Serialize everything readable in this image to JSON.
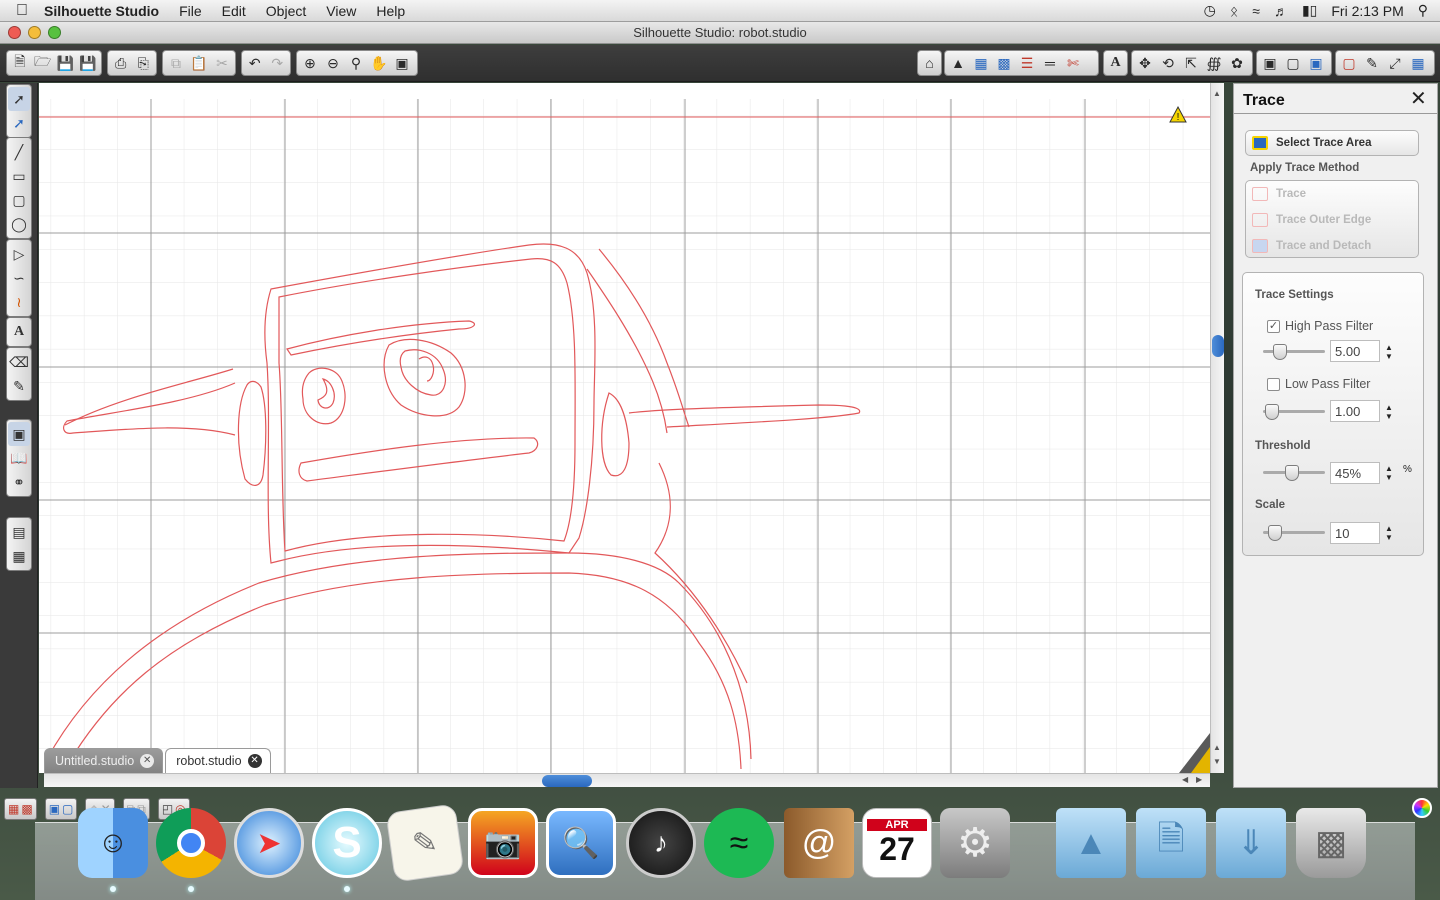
{
  "menubar": {
    "app_name": "Silhouette Studio",
    "menus": [
      "File",
      "Edit",
      "Object",
      "View",
      "Help"
    ],
    "clock": "Fri 2:13 PM"
  },
  "window": {
    "title": "Silhouette Studio: robot.studio"
  },
  "tabs": [
    {
      "label": "Untitled.studio",
      "active": false
    },
    {
      "label": "robot.studio",
      "active": true
    }
  ],
  "panel": {
    "title": "Trace",
    "select_trace_area": "Select Trace Area",
    "apply_trace_method": "Apply Trace Method",
    "methods": [
      "Trace",
      "Trace Outer Edge",
      "Trace and Detach"
    ],
    "settings_title": "Trace Settings",
    "high_pass": {
      "label": "High Pass Filter",
      "checked": true,
      "value": "5.00",
      "level": 0.2
    },
    "low_pass": {
      "label": "Low Pass Filter",
      "checked": false,
      "value": "1.00",
      "level": 0.05
    },
    "threshold": {
      "label": "Threshold",
      "value": "45%",
      "unit": "%",
      "level": 0.45
    },
    "scale": {
      "label": "Scale",
      "value": "10",
      "level": 0.1
    }
  },
  "dock_apps": [
    "Finder",
    "Chrome",
    "Safari",
    "Silhouette Studio",
    "TextEdit",
    "Image Capture",
    "iPhoto",
    "Dashboard",
    "Spotify",
    "Address Book",
    "iCal",
    "System Preferences",
    "Applications",
    "Documents",
    "Downloads",
    "Trash"
  ],
  "dock_date": {
    "month": "APR",
    "day": "27"
  },
  "colors": {
    "trace_line": "#e2585a",
    "grid_minor": "#e6e6e6",
    "grid_major": "#9c9c9c",
    "accent_blue": "#2a68bf"
  }
}
